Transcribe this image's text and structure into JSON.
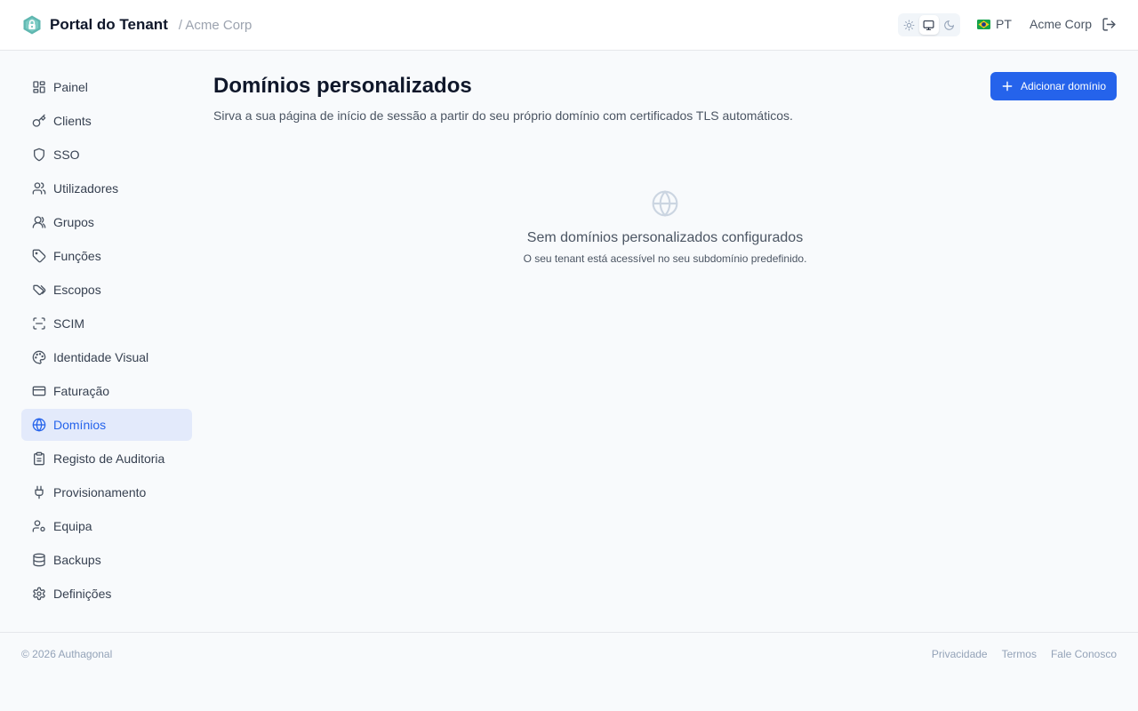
{
  "header": {
    "title": "Portal do Tenant",
    "tenant": "/ Acme Corp",
    "theme_options": [
      "sun-icon",
      "monitor-icon",
      "moon-icon"
    ],
    "theme_selected": "monitor-icon",
    "language": "PT",
    "account": "Acme Corp"
  },
  "sidebar": {
    "items": [
      {
        "label": "Painel",
        "icon": "dashboard-icon"
      },
      {
        "label": "Clients",
        "icon": "key-icon"
      },
      {
        "label": "SSO",
        "icon": "shield-icon"
      },
      {
        "label": "Utilizadores",
        "icon": "users-icon"
      },
      {
        "label": "Grupos",
        "icon": "group-icon"
      },
      {
        "label": "Funções",
        "icon": "tag-icon"
      },
      {
        "label": "Escopos",
        "icon": "tags-icon"
      },
      {
        "label": "SCIM",
        "icon": "scan-icon"
      },
      {
        "label": "Identidade Visual",
        "icon": "palette-icon"
      },
      {
        "label": "Faturação",
        "icon": "credit-card-icon"
      },
      {
        "label": "Domínios",
        "icon": "globe-icon"
      },
      {
        "label": "Registo de Auditoria",
        "icon": "clipboard-icon"
      },
      {
        "label": "Provisionamento",
        "icon": "plug-icon"
      },
      {
        "label": "Equipa",
        "icon": "user-cog-icon"
      },
      {
        "label": "Backups",
        "icon": "database-icon"
      },
      {
        "label": "Definições",
        "icon": "gear-icon"
      }
    ],
    "active": "Domínios"
  },
  "main": {
    "title": "Domínios personalizados",
    "subtitle": "Sirva a sua página de início de sessão a partir do seu próprio domínio com certificados TLS automáticos.",
    "add_button": "Adicionar domínio",
    "empty_title": "Sem domínios personalizados configurados",
    "empty_subtitle": "O seu tenant está acessível no seu subdomínio predefinido."
  },
  "footer": {
    "copyright": "© 2026 Authagonal",
    "links": [
      "Privacidade",
      "Termos",
      "Fale Conosco"
    ]
  },
  "colors": {
    "accent": "#2563eb",
    "active_bg": "#e3eafb",
    "brand_logo": "#5fb7b0"
  }
}
